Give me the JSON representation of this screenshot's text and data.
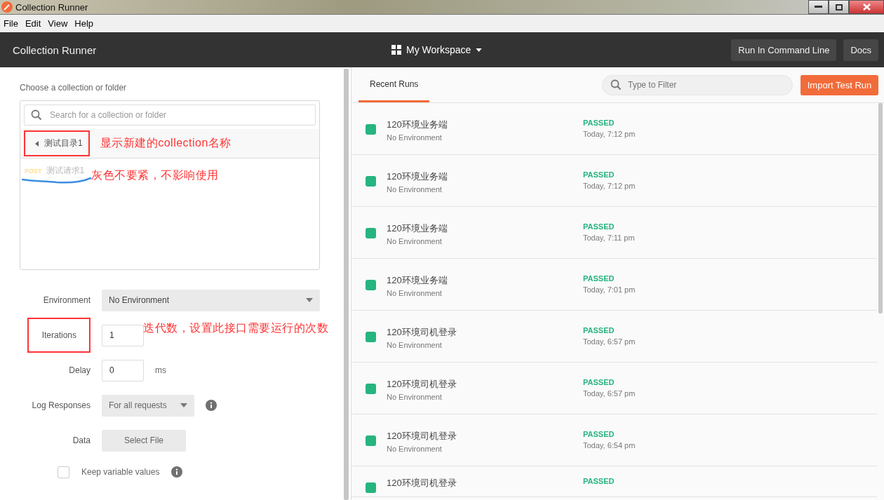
{
  "window": {
    "title": "Collection Runner"
  },
  "menu": [
    "File",
    "Edit",
    "View",
    "Help"
  ],
  "header": {
    "title": "Collection Runner",
    "workspace": "My Workspace",
    "buttons": [
      "Run In Command Line",
      "Docs"
    ]
  },
  "picker": {
    "label": "Choose a collection or folder",
    "search": {
      "placeholder": "Search for a collection or folder"
    },
    "collections": [
      {
        "name": "测试目录1",
        "expanded": false,
        "highlighted": true,
        "note": "显示新建的collection名称",
        "children": [
          {
            "method": "POST",
            "name": "测试请求1",
            "disabled": true,
            "note": "灰色不要紧，不影响使用"
          }
        ]
      }
    ]
  },
  "form": [
    {
      "kind": "select",
      "label": "Environment",
      "value": "No Environment"
    },
    {
      "kind": "number",
      "label": "Iterations",
      "value": "1",
      "highlighted": true,
      "note": "迭代数，设置此接口需要运行的次数"
    },
    {
      "kind": "number",
      "label": "Delay",
      "value": "0",
      "unit": "ms"
    },
    {
      "kind": "select-small",
      "label": "Log Responses",
      "value": "For all requests",
      "info": true
    },
    {
      "kind": "file",
      "label": "Data",
      "value": "Select File"
    },
    {
      "kind": "checkbox",
      "label": "Keep variable values",
      "checked": false,
      "info": true
    }
  ],
  "runs_panel": {
    "tabs": [
      {
        "label": "Recent Runs",
        "selected": true
      }
    ],
    "filter": {
      "placeholder": "Type to Filter"
    },
    "import_button": "Import Test Run",
    "runs": [
      {
        "name": "120环境业务端",
        "environment": "No Environment",
        "status": "PASSED",
        "time": "Today, 7:12 pm",
        "color": "#26b47f"
      },
      {
        "name": "120环境业务端",
        "environment": "No Environment",
        "status": "PASSED",
        "time": "Today, 7:12 pm",
        "color": "#26b47f"
      },
      {
        "name": "120环境业务端",
        "environment": "No Environment",
        "status": "PASSED",
        "time": "Today, 7:11 pm",
        "color": "#26b47f"
      },
      {
        "name": "120环境业务端",
        "environment": "No Environment",
        "status": "PASSED",
        "time": "Today, 7:01 pm",
        "color": "#26b47f"
      },
      {
        "name": "120环境司机登录",
        "environment": "No Environment",
        "status": "PASSED",
        "time": "Today, 6:57 pm",
        "color": "#26b47f"
      },
      {
        "name": "120环境司机登录",
        "environment": "No Environment",
        "status": "PASSED",
        "time": "Today, 6:57 pm",
        "color": "#26b47f"
      },
      {
        "name": "120环境司机登录",
        "environment": "No Environment",
        "status": "PASSED",
        "time": "Today, 6:54 pm",
        "color": "#26b47f"
      },
      {
        "name": "120环境司机登录",
        "status": "PASSED",
        "color": "#26b47f"
      }
    ]
  }
}
